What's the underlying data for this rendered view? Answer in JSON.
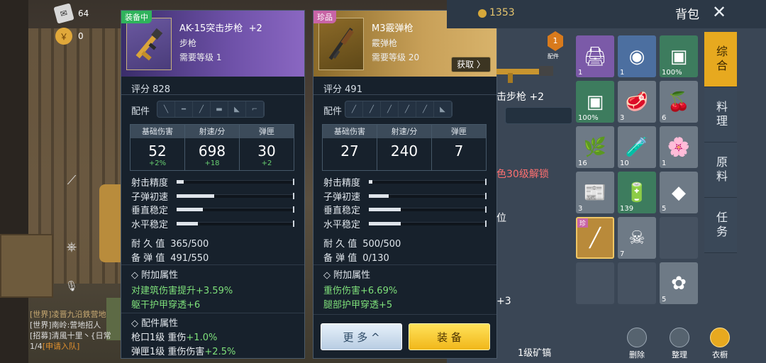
{
  "resources": {
    "paper": "64",
    "gold": "0"
  },
  "chat": {
    "line1": "[世界]凌晋九沿鉄营地",
    "line2": "[世界]南岭:营地招人",
    "line3": "[招募]清風十里丶{日常",
    "page": "1/4",
    "apply": "[申请入队]"
  },
  "left_item": {
    "tag": "装备中",
    "name": "AK-15突击步枪",
    "plus": "+2",
    "type": "步枪",
    "level_label": "需要等级",
    "level": "1",
    "score_label": "评分",
    "score": "828",
    "parts_label": "配件",
    "stats": [
      {
        "label": "基础伤害",
        "value": "52",
        "delta": "+2%"
      },
      {
        "label": "射速/分",
        "value": "698",
        "delta": "+18"
      },
      {
        "label": "弹匣",
        "value": "30",
        "delta": "+2"
      }
    ],
    "bars": [
      {
        "label": "射击精度",
        "fill": 0.06
      },
      {
        "label": "子弹初速",
        "fill": 0.32
      },
      {
        "label": "垂直稳定",
        "fill": 0.22
      },
      {
        "label": "水平稳定",
        "fill": 0.18
      }
    ],
    "durability_label": "耐 久 值",
    "durability": "365/500",
    "ammo_label": "备 弹 值",
    "ammo": "491/550",
    "extra_title": "◇ 附加属性",
    "extra": [
      {
        "name": "对建筑伤害提升",
        "value": "+3.59%"
      },
      {
        "name": "躯干护甲穿透",
        "value": "+6"
      }
    ],
    "parts_title": "◇ 配件属性",
    "part_attrs": [
      {
        "name": "枪口1级 重伤",
        "value": "+1.0%"
      },
      {
        "name": "弹匣1级 重伤伤害",
        "value": "+2.5%"
      }
    ]
  },
  "right_item": {
    "tag": "珍品",
    "name": "M3霰弹枪",
    "type": "霰弹枪",
    "level_label": "需要等级",
    "level": "20",
    "get_label": "获取 〉",
    "score_label": "评分",
    "score": "491",
    "parts_label": "配件",
    "stats": [
      {
        "label": "基础伤害",
        "value": "27"
      },
      {
        "label": "射速/分",
        "value": "240"
      },
      {
        "label": "弹匣",
        "value": "7"
      }
    ],
    "bars": [
      {
        "label": "射击精度",
        "fill": 0.03
      },
      {
        "label": "子弹初速",
        "fill": 0.17
      },
      {
        "label": "垂直稳定",
        "fill": 0.27
      },
      {
        "label": "水平稳定",
        "fill": 0.27
      }
    ],
    "durability_label": "耐 久 值",
    "durability": "500/500",
    "ammo_label": "备 弹 值",
    "ammo": "0/130",
    "extra_title": "◇ 附加属性",
    "extra": [
      {
        "name": "重伤伤害",
        "value": "+6.69%"
      },
      {
        "name": "腿部护甲穿透",
        "value": "+5"
      }
    ],
    "more_label": "更 多 ^",
    "equip_label": "装 备"
  },
  "inventory": {
    "coins": "1353",
    "title": "背包",
    "under_text": {
      "badge": "配件",
      "badge_num": "1",
      "gun_name": "击步枪 +2",
      "unlock": "色30级解锁",
      "pos": "位",
      "plus": "+3",
      "pickaxe": "1级矿镐"
    },
    "cells": [
      {
        "icon": "🖨",
        "count": "1",
        "color": "c-purple"
      },
      {
        "icon": "◉",
        "count": "1",
        "color": "c-blue"
      },
      {
        "icon": "▣",
        "count": "100%",
        "color": "c-green"
      },
      {
        "icon": "▣",
        "count": "100%",
        "color": "c-green"
      },
      {
        "icon": "🥩",
        "count": "3",
        "color": "c-grey"
      },
      {
        "icon": "🍒",
        "count": "6",
        "color": "c-grey"
      },
      {
        "icon": "🌿",
        "count": "16",
        "color": "c-grey"
      },
      {
        "icon": "🧪",
        "count": "10",
        "color": "c-grey"
      },
      {
        "icon": "🌸",
        "count": "1",
        "color": "c-grey"
      },
      {
        "icon": "📰",
        "count": "3",
        "color": "c-grey"
      },
      {
        "icon": "🔋",
        "count": "139",
        "color": "c-green"
      },
      {
        "icon": "◆",
        "count": "5",
        "color": "c-grey"
      },
      {
        "icon": "╱",
        "count": "",
        "color": "c-gold",
        "rare": "珍"
      },
      {
        "icon": "☠",
        "count": "7",
        "color": "c-grey"
      },
      {
        "icon": "",
        "count": "",
        "color": "c-empty"
      },
      {
        "icon": "",
        "count": "",
        "color": "c-empty"
      },
      {
        "icon": "",
        "count": "",
        "color": "c-empty"
      },
      {
        "icon": "✿",
        "count": "5",
        "color": "c-grey"
      }
    ],
    "tabs": [
      "综合",
      "料理",
      "原料",
      "任务"
    ],
    "bottom": {
      "delete": "删除",
      "sort": "整理",
      "wardrobe": "衣橱"
    }
  },
  "colors": {
    "equipped_tag": "#2fb35c",
    "rare_tag": "#c864a6",
    "delta_green": "#68d070",
    "equip_btn": "#f1b71a"
  }
}
